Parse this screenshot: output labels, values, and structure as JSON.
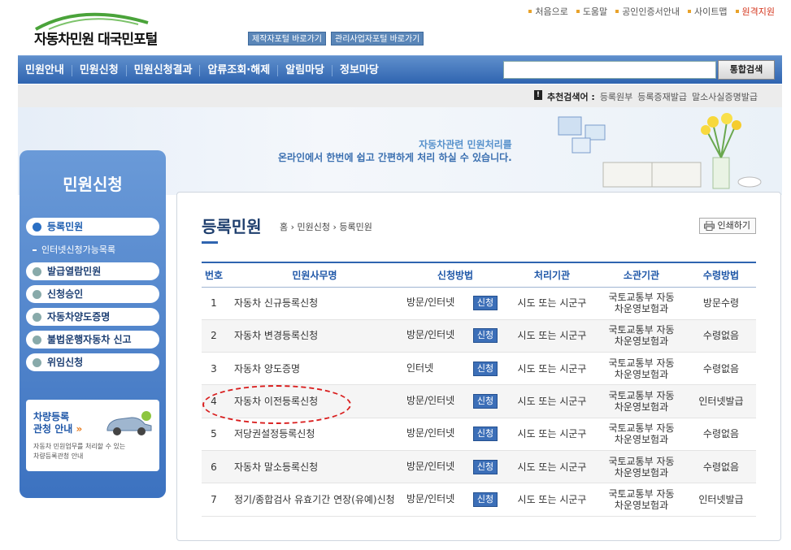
{
  "header": {
    "logo_text": "자동차민원 대국민포털",
    "quick_links": [
      "제작자포털 바로가기",
      "관리사업자포털 바로가기"
    ],
    "top_links": [
      "처음으로",
      "도움말",
      "공인인증서안내",
      "사이트맵",
      "원격지원"
    ]
  },
  "nav": {
    "items": [
      "민원안내",
      "민원신청",
      "민원신청결과",
      "압류조회·해제",
      "알림마당",
      "정보마당"
    ],
    "search_button": "통합검색"
  },
  "recommend": {
    "label": "추천검색어 :",
    "items": [
      "등록원부",
      "등록증재발급",
      "말소사실증명발급"
    ]
  },
  "banner": {
    "line1": "자동차관련 민원처리를",
    "line2": "온라인에서 한번에 쉽고 간편하게 처리 하실 수 있습니다."
  },
  "sidebar": {
    "title": "민원신청",
    "items": [
      "등록민원",
      "발급열람민원",
      "신청승인",
      "자동차양도증명",
      "불법운행자동차 신고",
      "위임신청"
    ],
    "sub_item": "인터넷신청가능목록",
    "promo_title_1": "차량등록",
    "promo_title_2": "관청 안내",
    "promo_desc_1": "자동차 민원업무를 처리할 수 있는",
    "promo_desc_2": "차량등록관청 안내"
  },
  "content": {
    "title": "등록민원",
    "breadcrumb": [
      "홈",
      "민원신청",
      "등록민원"
    ],
    "print_label": "인쇄하기",
    "columns": [
      "번호",
      "민원사무명",
      "신청방법",
      "처리기관",
      "소관기관",
      "수령방법"
    ],
    "apply_label": "신청",
    "rows": [
      {
        "no": "1",
        "name": "자동차 신규등록신청",
        "method": "방문/인터넷",
        "agency": "시도 또는 시군구",
        "dept1": "국토교통부 자동",
        "dept2": "차운영보험과",
        "receive": "방문수령"
      },
      {
        "no": "2",
        "name": "자동차 변경등록신청",
        "method": "방문/인터넷",
        "agency": "시도 또는 시군구",
        "dept1": "국토교통부 자동",
        "dept2": "차운영보험과",
        "receive": "수령없음"
      },
      {
        "no": "3",
        "name": "자동차 양도증명",
        "method": "인터넷",
        "agency": "시도 또는 시군구",
        "dept1": "국토교통부 자동",
        "dept2": "차운영보험과",
        "receive": "수령없음"
      },
      {
        "no": "4",
        "name": "자동차 이전등록신청",
        "method": "방문/인터넷",
        "agency": "시도 또는 시군구",
        "dept1": "국토교통부 자동",
        "dept2": "차운영보험과",
        "receive": "인터넷발급"
      },
      {
        "no": "5",
        "name": "저당권설정등록신청",
        "method": "방문/인터넷",
        "agency": "시도 또는 시군구",
        "dept1": "국토교통부 자동",
        "dept2": "차운영보험과",
        "receive": "수령없음"
      },
      {
        "no": "6",
        "name": "자동차 말소등록신청",
        "method": "방문/인터넷",
        "agency": "시도 또는 시군구",
        "dept1": "국토교통부 자동",
        "dept2": "차운영보험과",
        "receive": "수령없음"
      },
      {
        "no": "7",
        "name": "정기/종합검사 유효기간 연장(유예)신청",
        "method": "방문/인터넷",
        "agency": "시도 또는 시군구",
        "dept1": "국토교통부 자동",
        "dept2": "차운영보험과",
        "receive": "인터넷발급"
      }
    ]
  },
  "colors": {
    "nav_blue": "#2f64b0",
    "highlight_red": "#d91d1d",
    "apply_blue": "#3c6fb8"
  }
}
